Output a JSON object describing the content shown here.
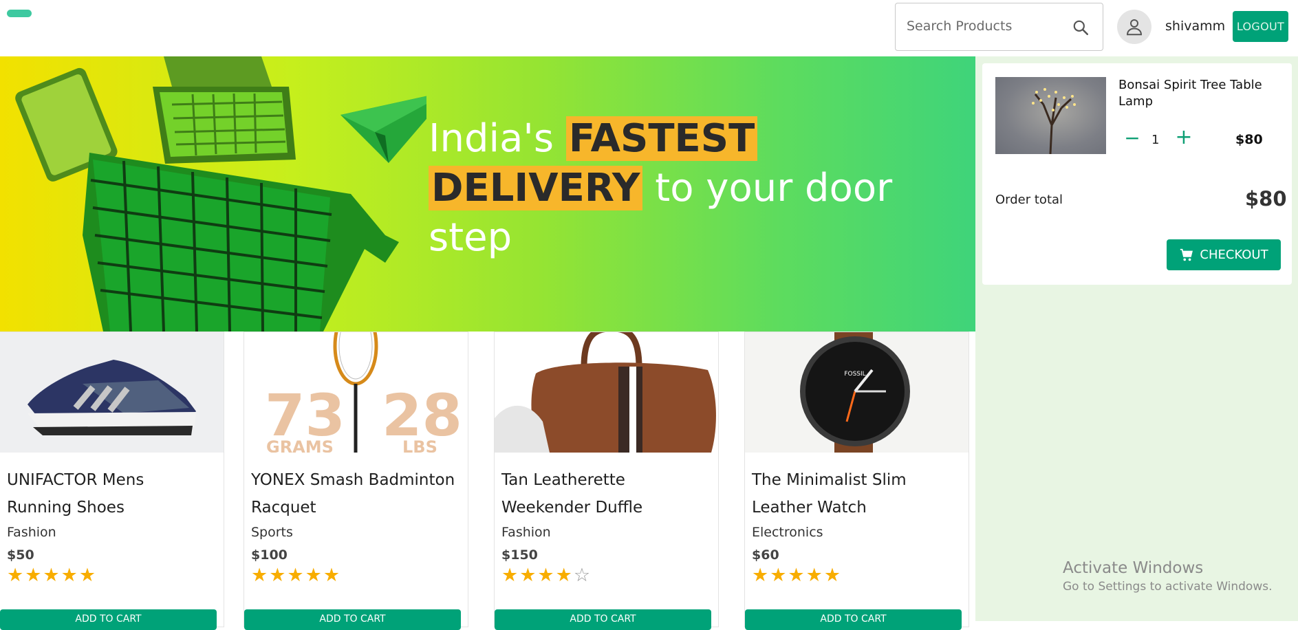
{
  "header": {
    "search_placeholder": "Search Products",
    "username": "shivamm",
    "logout_label": "LOGOUT"
  },
  "hero": {
    "text_1": "India's",
    "text_2": "FASTEST",
    "text_3": "DELIVERY",
    "text_4": "to your door step"
  },
  "cart": {
    "item_name": "Bonsai Spirit Tree Table Lamp",
    "quantity": "1",
    "item_price": "$80",
    "order_total_label": "Order total",
    "order_total": "$80",
    "checkout_label": "CHECKOUT"
  },
  "products": [
    {
      "name": "UNIFACTOR Mens Running Shoes",
      "category": "Fashion",
      "price": "$50",
      "rating": 5,
      "add_label": "ADD TO CART"
    },
    {
      "name": "YONEX Smash Badminton Racquet",
      "category": "Sports",
      "price": "$100",
      "rating": 5,
      "add_label": "ADD TO CART",
      "img_text_left": "73",
      "img_sub_left": "GRAMS",
      "img_text_right": "28",
      "img_sub_right": "LBS"
    },
    {
      "name": "Tan Leatherette Weekender Duffle",
      "category": "Fashion",
      "price": "$150",
      "rating": 4,
      "add_label": "ADD TO CART"
    },
    {
      "name": "The Minimalist Slim Leather Watch",
      "category": "Electronics",
      "price": "$60",
      "rating": 5,
      "add_label": "ADD TO CART",
      "img_brand": "FOSSIL"
    }
  ],
  "watermark": {
    "line1": "Activate Windows",
    "line2": "Go to Settings to activate Windows."
  },
  "colors": {
    "accent": "#00a278",
    "highlight": "#f7b62b",
    "star": "#f8ad00",
    "side_bg": "#e8f5e3"
  }
}
